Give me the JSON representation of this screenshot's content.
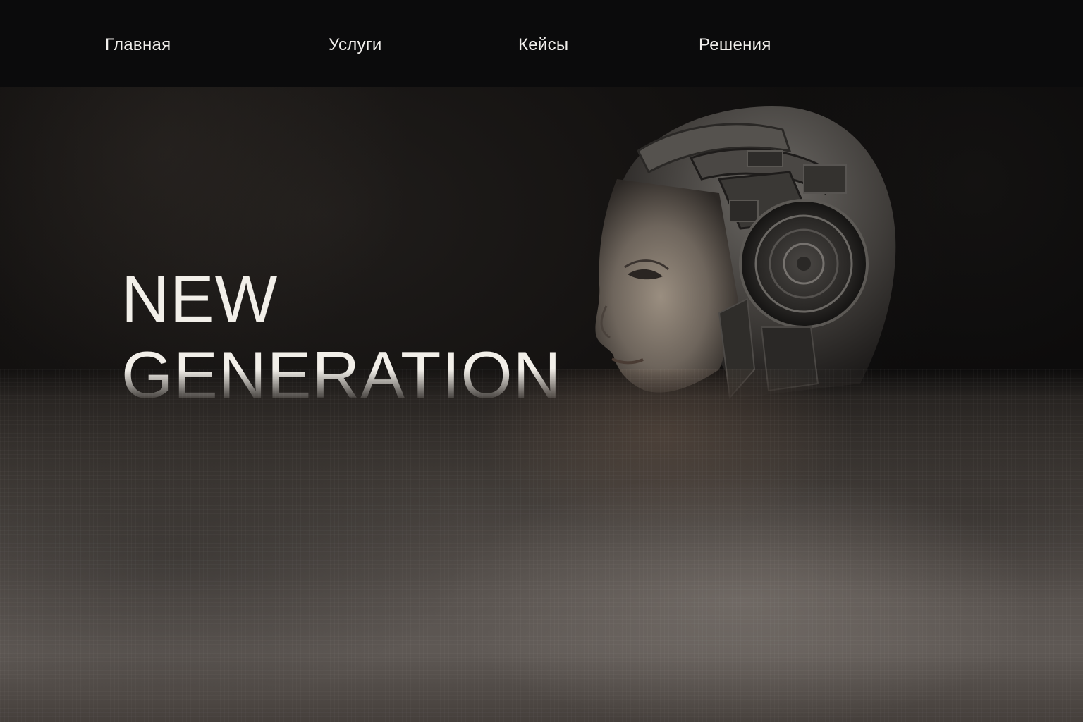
{
  "nav": {
    "items": [
      {
        "label": "Главная"
      },
      {
        "label": "Услуги"
      },
      {
        "label": "Кейсы"
      },
      {
        "label": "Решения"
      }
    ]
  },
  "hero": {
    "title_line_1": "NEW",
    "title_line_2": "GENERATION",
    "image_icon": "cyborg-woman-portrait"
  },
  "colors": {
    "background": "#0c0b0b",
    "text": "#f2efe9",
    "divider": "#3a3a3c",
    "fog": "#5f5955"
  }
}
